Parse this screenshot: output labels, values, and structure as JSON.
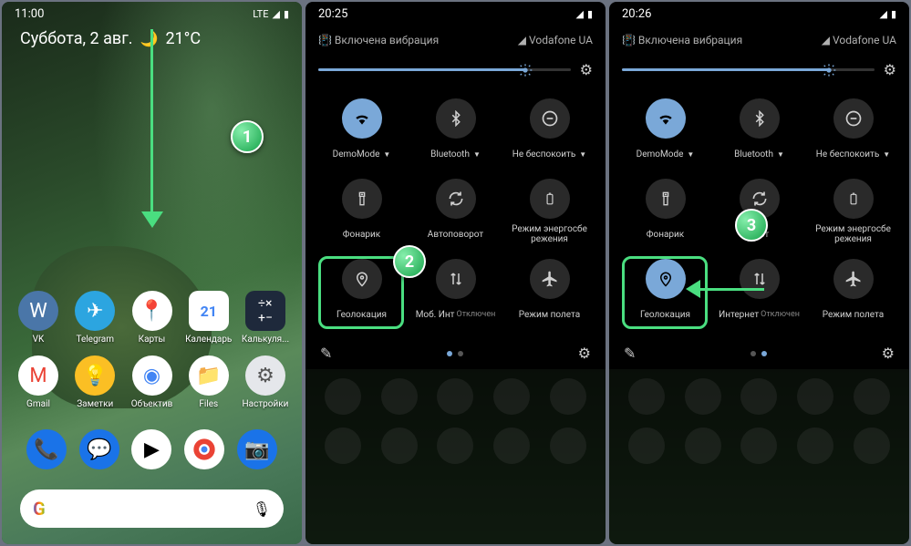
{
  "home": {
    "time": "11:00",
    "network": "LTE",
    "weather_date": "Суббота, 2 авг.",
    "weather_temp": "21°C",
    "apps_row1": [
      {
        "label": "VK",
        "color": "#4a76a8"
      },
      {
        "label": "Telegram",
        "color": "#2ca5e0"
      },
      {
        "label": "Карты",
        "color": "#fff"
      },
      {
        "label": "Календарь",
        "color": "#fff"
      },
      {
        "label": "Калькуля...",
        "color": "#1e293b"
      }
    ],
    "apps_row2": [
      {
        "label": "Gmail",
        "color": "#fff"
      },
      {
        "label": "Заметки",
        "color": "#fbbf24"
      },
      {
        "label": "Объектив",
        "color": "#fff"
      },
      {
        "label": "Files",
        "color": "#fff"
      },
      {
        "label": "Настройки",
        "color": "#e5e7eb"
      }
    ]
  },
  "panel2": {
    "time": "20:25",
    "carrier": "Vodafone UA",
    "vibration": "Включена вибрация",
    "tiles": [
      {
        "label": "DemoMode",
        "dropdown": true,
        "active": true,
        "icon": "wifi"
      },
      {
        "label": "Bluetooth",
        "dropdown": true,
        "active": false,
        "icon": "bluetooth"
      },
      {
        "label": "Не беспокоить",
        "dropdown": true,
        "active": false,
        "icon": "dnd"
      },
      {
        "label": "Фонарик",
        "active": false,
        "icon": "flashlight"
      },
      {
        "label": "Автоповорот",
        "active": false,
        "icon": "rotate"
      },
      {
        "label": "Режим энергосбе режения",
        "active": false,
        "icon": "battery"
      },
      {
        "label": "Геолокация",
        "active": false,
        "icon": "location"
      },
      {
        "label": "Моб. Инт",
        "sub": "Отключен",
        "active": false,
        "icon": "data"
      },
      {
        "label": "Режим полета",
        "active": false,
        "icon": "airplane"
      }
    ]
  },
  "panel3": {
    "time": "20:26",
    "carrier": "Vodafone UA",
    "vibration": "Включена вибрация",
    "tiles": [
      {
        "label": "DemoMode",
        "dropdown": true,
        "active": true,
        "icon": "wifi"
      },
      {
        "label": "Bluetooth",
        "dropdown": true,
        "active": false,
        "icon": "bluetooth"
      },
      {
        "label": "Не беспокоить",
        "dropdown": true,
        "active": false,
        "icon": "dnd"
      },
      {
        "label": "Фонарик",
        "active": false,
        "icon": "flashlight"
      },
      {
        "label": "орот",
        "active": false,
        "icon": "rotate"
      },
      {
        "label": "Режим энергосбе режения",
        "active": false,
        "icon": "battery"
      },
      {
        "label": "Геолокация",
        "active": true,
        "icon": "location"
      },
      {
        "label": "Интернет",
        "sub": "Отключен",
        "active": false,
        "icon": "data"
      },
      {
        "label": "Режим полета",
        "active": false,
        "icon": "airplane"
      }
    ]
  },
  "badges": {
    "b1": "1",
    "b2": "2",
    "b3": "3"
  },
  "search_label": "G"
}
